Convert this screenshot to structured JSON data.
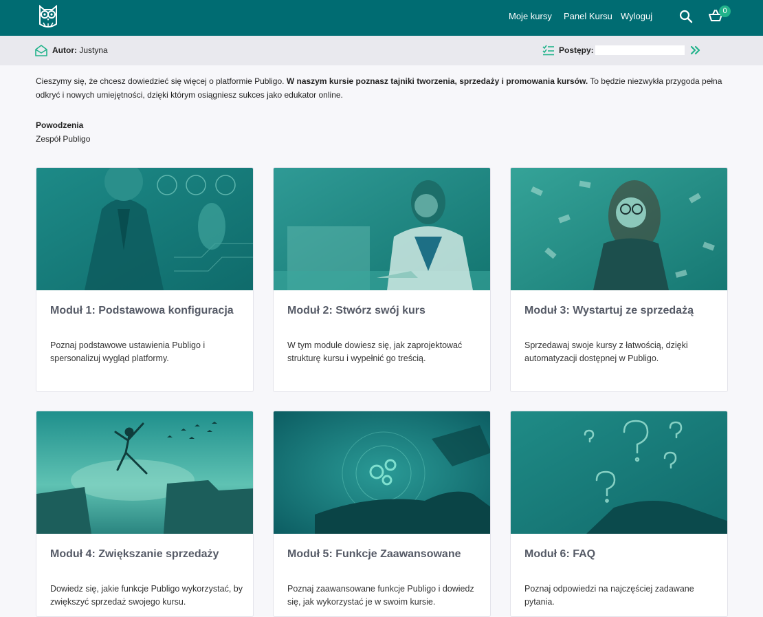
{
  "nav": {
    "links": [
      "Moje kursy",
      "Panel Kursu",
      "Wyloguj"
    ],
    "cart_count": "0"
  },
  "infobar": {
    "author_label": "Autor:",
    "author_name": "Justyna",
    "progress_label": "Postępy:",
    "progress_value": 0
  },
  "intro": {
    "text_1": "Cieszymy się, że chcesz dowiedzieć się więcej o platformie Publigo. ",
    "text_bold": "W naszym kursie poznasz tajniki tworzenia, sprzedaży i promowania kursów.",
    "text_2": " To będzie niezwykła przygoda pełna odkryć i nowych umiejętności, dzięki którym osiągniesz sukces jako edukator online.",
    "sign_bold": "Powodzenia",
    "sign": "Zespół Publigo"
  },
  "modules": [
    {
      "title": "Moduł 1: Podstawowa konfiguracja",
      "desc": "Poznaj podstawowe ustawienia Publigo i spersonalizuj wygląd platformy."
    },
    {
      "title": "Moduł 2: Stwórz swój kurs",
      "desc": "W tym module dowiesz się, jak zaprojektować strukturę kursu i wypełnić go treścią."
    },
    {
      "title": "Moduł 3: Wystartuj ze sprzedażą",
      "desc": "Sprzedawaj swoje kursy z łatwością, dzięki automatyzacji dostępnej w Publigo."
    },
    {
      "title": "Moduł 4: Zwiększanie sprzedaży",
      "desc": "Dowiedz się, jakie funkcje Publigo wykorzystać, by zwiększyć sprzedaż swojego kursu."
    },
    {
      "title": "Moduł 5: Funkcje Zaawansowane",
      "desc": "Poznaj zaawansowane funkcje Publigo i dowiedz się, jak wykorzystać je w swoim kursie."
    },
    {
      "title": "Moduł 6: FAQ",
      "desc": "Poznaj odpowiedzi na najczęściej zadawane pytania."
    }
  ],
  "colors": {
    "brand": "#006c72",
    "accent": "#22b38b"
  },
  "icons": [
    "owl-logo-icon",
    "search-icon",
    "cart-icon",
    "envelope-open-icon",
    "checklist-icon",
    "double-chevron-right-icon"
  ]
}
